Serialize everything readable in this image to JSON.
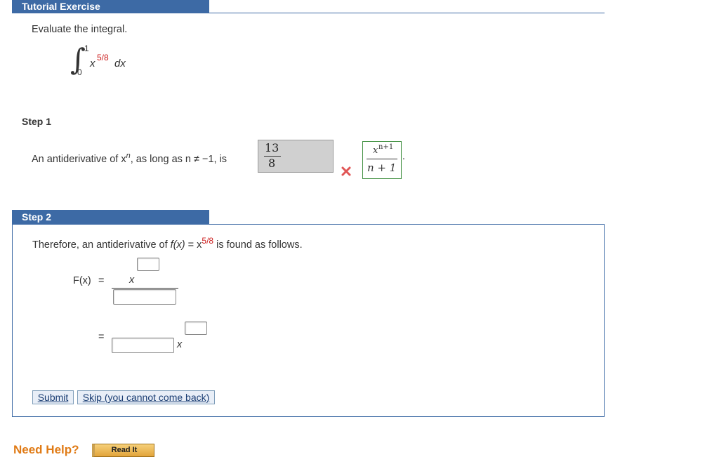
{
  "header": {
    "title": "Tutorial Exercise"
  },
  "problem": {
    "prompt": "Evaluate the integral.",
    "integral_sign": "∫",
    "upper_limit": "1",
    "lower_limit": "0",
    "base": "x",
    "exponent": "5/8",
    "differential": "dx"
  },
  "step1": {
    "label": "Step 1",
    "text_before": "An antiderivative of x",
    "text_exp": "n",
    "text_after": ", as long as n ≠ −1, is",
    "answer_num": "13",
    "answer_den": "8",
    "result": "incorrect",
    "correct_num_base": "x",
    "correct_num_exp": "n+1",
    "correct_den": "n + 1",
    "period": "."
  },
  "step2": {
    "label": "Step 2",
    "text_before": "Therefore, an antiderivative of ",
    "fx": "f(x)",
    "eq": " = x",
    "exp": "5/8",
    "text_after": " is found as follows.",
    "Fx_label": "F(x)",
    "equals": "=",
    "x_var": "x",
    "equals2": "=",
    "x_var2": "x"
  },
  "buttons": {
    "submit": "Submit",
    "skip": "Skip (you cannot come back)"
  },
  "help": {
    "label": "Need Help?",
    "read_it": "Read It"
  },
  "colors": {
    "accent": "#3d6aa5",
    "error": "#e05555",
    "correct_border": "#3f8f3f",
    "help_orange": "#e07b16"
  }
}
